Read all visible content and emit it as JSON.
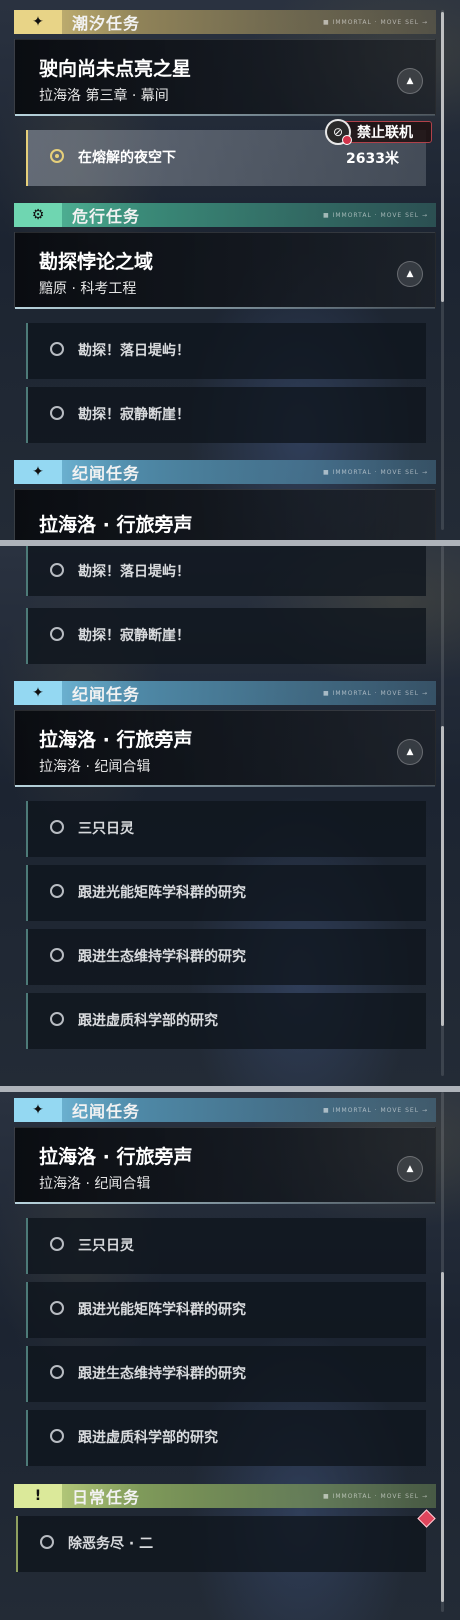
{
  "frame1": {
    "tidal_category": {
      "label": "潮汐任务",
      "icon": "star-sparkle-icon",
      "deco": "■ IMMORTAL · MOVE SEL →"
    },
    "tidal_quest": {
      "title": "驶向尚未点亮之星",
      "subtitle": "拉海洛 第三章 · 幕间"
    },
    "tidal_step": {
      "label": "在熔解的夜空下",
      "status_badge": "禁止联机",
      "distance": "2633米"
    },
    "peril_category": {
      "label": "危行任务",
      "icon": "gear-eye-icon",
      "deco": "■ IMMORTAL · MOVE SEL →"
    },
    "peril_quest": {
      "title": "勘探悖论之域",
      "subtitle": "黯原 · 科考工程"
    },
    "peril_steps": [
      "勘探！落日堤屿！",
      "勘探！寂静断崖！"
    ],
    "chronicle_category": {
      "label": "纪闻任务",
      "icon": "star-sparkle-icon",
      "deco": "■ IMMORTAL · MOVE SEL →"
    },
    "chronicle_peek_title": "拉海洛 · 行旅旁声"
  },
  "frame2": {
    "peril_steps": [
      "勘探！落日堤屿！",
      "勘探！寂静断崖！"
    ],
    "chronicle_category": {
      "label": "纪闻任务",
      "icon": "star-sparkle-icon",
      "deco": "■ IMMORTAL · MOVE SEL →"
    },
    "chronicle_quest": {
      "title": "拉海洛 · 行旅旁声",
      "subtitle": "拉海洛 · 纪闻合辑"
    },
    "chronicle_steps": [
      "三只日灵",
      "跟进光能矩阵学科群的研究",
      "跟进生态维持学科群的研究",
      "跟进虚质科学部的研究"
    ]
  },
  "frame3": {
    "chronicle_category": {
      "label": "纪闻任务",
      "icon": "star-sparkle-icon",
      "deco": "■ IMMORTAL · MOVE SEL →"
    },
    "chronicle_quest": {
      "title": "拉海洛 · 行旅旁声",
      "subtitle": "拉海洛 · 纪闻合辑"
    },
    "chronicle_steps": [
      "三只日灵",
      "跟进光能矩阵学科群的研究",
      "跟进生态维持学科群的研究",
      "跟进虚质科学部的研究"
    ],
    "daily_category": {
      "label": "日常任务",
      "icon": "exclamation-box-icon",
      "deco": "■ IMMORTAL · MOVE SEL →"
    },
    "daily_steps": [
      "除恶务尽 · 二"
    ]
  }
}
